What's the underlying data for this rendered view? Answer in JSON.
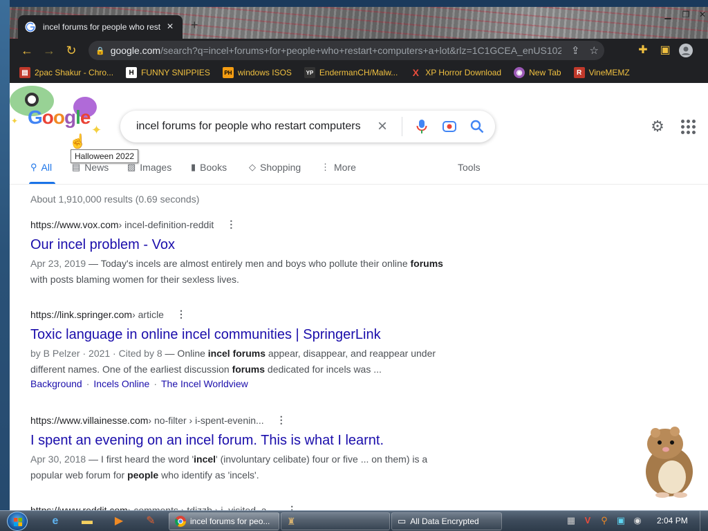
{
  "browser": {
    "tab_title": "incel forums for people who rest",
    "url_host": "google.com",
    "url_path": "/search?q=incel+forums+for+people+who+restart+computers+a+lot&rlz=1C1GCEA_enUS1028..."
  },
  "bookmarks": [
    {
      "label": "2pac Shakur - Chro...",
      "icon": "document-icon",
      "color": "#c0392b"
    },
    {
      "label": "FUNNY SNIPPIES",
      "icon": "H",
      "color": "#ffffff"
    },
    {
      "label": "windows ISOS",
      "icon": "PH",
      "color": "#f39c12"
    },
    {
      "label": "EndermanCH/Malw...",
      "icon": "YP",
      "color": "#ffffff"
    },
    {
      "label": "XP Horror Download",
      "icon": "X",
      "color": "#e74c3c"
    },
    {
      "label": "New Tab",
      "icon": "globe-icon",
      "color": "#9b59b6"
    },
    {
      "label": "VineMEMZ",
      "icon": "R",
      "color": "#e74c3c"
    }
  ],
  "search": {
    "query": "incel forums for people who restart computers a",
    "logo_text": "Google",
    "doodle_tooltip": "Halloween 2022"
  },
  "search_tabs": [
    {
      "label": "All",
      "icon": "search-icon",
      "active": true
    },
    {
      "label": "News",
      "icon": "news-icon"
    },
    {
      "label": "Images",
      "icon": "image-icon"
    },
    {
      "label": "Books",
      "icon": "book-icon"
    },
    {
      "label": "Shopping",
      "icon": "tag-icon"
    },
    {
      "label": "More",
      "icon": "kebab-icon"
    }
  ],
  "tools_label": "Tools",
  "stats": "About 1,910,000 results (0.69 seconds)",
  "results": [
    {
      "cite_url": "https://www.vox.com",
      "cite_path": " › incel-definition-reddit",
      "title": "Our incel problem - Vox",
      "date": "Apr 23, 2019",
      "snippet_a": " — Today's incels are almost entirely men and boys who pollute their online ",
      "snippet_b": "forums",
      "snippet_c": " with posts blaming women for their sexless lives."
    },
    {
      "cite_url": "https://link.springer.com",
      "cite_path": " › article",
      "title": "Toxic language in online incel communities | SpringerLink",
      "date": "by B Pelzer · 2021 · Cited by 8",
      "snippet_a": " — Online ",
      "snippet_b": "incel forums",
      "snippet_c": " appear, disappear, and reappear under different names. One of the earliest discussion ",
      "snippet_d": "forums",
      "snippet_e": " dedicated for incels was ...",
      "sitelinks": [
        "Background",
        "Incels Online",
        "The Incel Worldview"
      ]
    },
    {
      "cite_url": "https://www.villainesse.com",
      "cite_path": " › no-filter › i-spent-evenin...",
      "title": "I spent an evening on an incel forum. This is what I learnt.",
      "date": "Apr 30, 2018",
      "snippet_a": " — I first heard the word '",
      "snippet_b": "incel",
      "snippet_c": "' (involuntary celibate) four or five ... on them) is a popular web forum for ",
      "snippet_d": "people",
      "snippet_e": " who identify as 'incels'."
    },
    {
      "cite_url": "https://www.reddit.com",
      "cite_path": " › comments › tdjzzb › i_visited_a..."
    }
  ],
  "taskbar": {
    "tasks": [
      {
        "label": "incel forums for peo...",
        "active": true
      },
      {
        "label": "",
        "active": false
      },
      {
        "label": "All Data Encrypted",
        "active": false
      }
    ],
    "clock": "2:04 PM"
  },
  "colors": {
    "link": "#1a0dab",
    "accent": "#1a73e8",
    "bookmark_text": "#f0c040"
  }
}
